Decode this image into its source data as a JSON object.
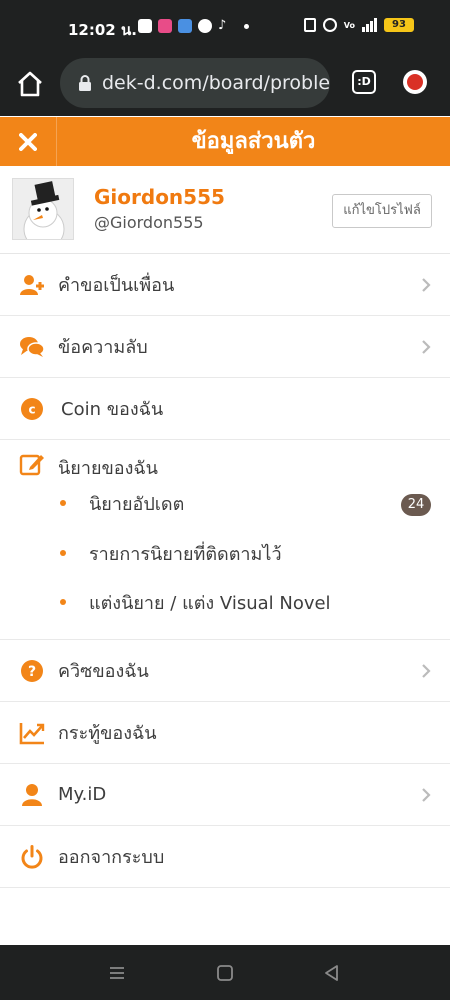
{
  "status": {
    "time": "12:02 น.",
    "battery": "93"
  },
  "browser": {
    "url": "dek-d.com/board/proble",
    "tabs_label": ":D"
  },
  "header": {
    "title": "ข้อมูลส่วนตัว"
  },
  "profile": {
    "name": "Giordon555",
    "handle": "@Giordon555",
    "edit_label": "แก้ไขโปรไฟล์"
  },
  "menu": {
    "friend_requests": "คำขอเป็นเพื่อน",
    "messages": "ข้อความลับ",
    "coin": "Coin ของฉัน",
    "novels": "นิยายของฉัน",
    "novel_updates": "นิยายอัปเดต",
    "novel_updates_count": "24",
    "following": "รายการนิยายที่ติดตามไว้",
    "write": "แต่งนิยาย / แต่ง Visual Novel",
    "quiz": "ควิซของฉัน",
    "board": "กระทู้ของฉัน",
    "myid": "My.iD",
    "logout": "ออกจากระบบ"
  },
  "colors": {
    "brand_orange": "#f28518",
    "badge": "#6b5a50"
  }
}
